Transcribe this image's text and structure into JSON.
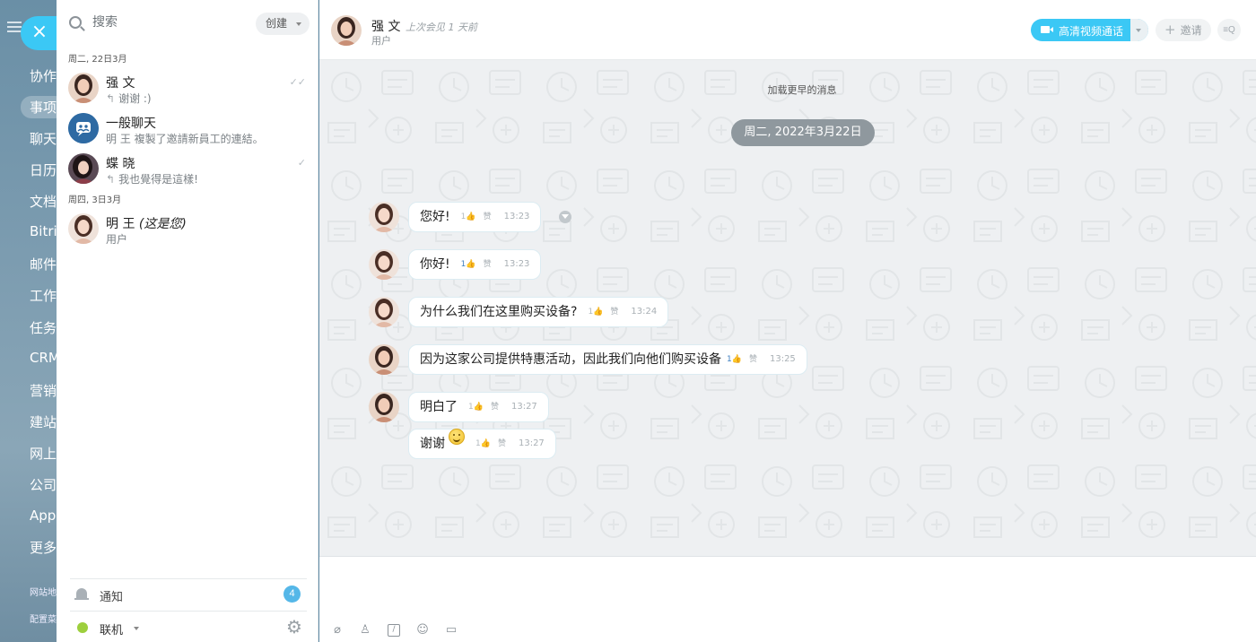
{
  "bitrix_menu": {
    "items": [
      "协作",
      "事项",
      "聊天",
      "日历",
      "文档",
      "Bitri",
      "邮件",
      "工作",
      "任务",
      "CRM",
      "营销",
      "建站",
      "网上",
      "公司",
      "Appl",
      "更多"
    ],
    "active_index": 1,
    "footer_items": [
      "网站地",
      "配置菜"
    ]
  },
  "close_icon": "×",
  "recent": {
    "search_placeholder": "搜索",
    "create_label": "创建",
    "groups": [
      {
        "date": "周二, 22日3月",
        "items": [
          {
            "name": "强 文",
            "preview": "谢谢 :)",
            "reply": true,
            "read": true,
            "avatar": "woman-1"
          },
          {
            "name": "一般聊天",
            "preview": "明 王 複製了邀請新員工的連結。",
            "reply": false,
            "read": false,
            "avatar": "group-icon"
          },
          {
            "name": "蝶 晓",
            "preview": "我也覺得是這樣!",
            "reply": true,
            "read": true,
            "avatar": "woman-2"
          }
        ]
      },
      {
        "date": "周四, 3日3月",
        "items": [
          {
            "name": "明 王",
            "name_suffix": "(这是您)",
            "preview": "用户",
            "reply": false,
            "read": false,
            "avatar": "woman-3"
          }
        ]
      }
    ],
    "notifications_label": "通知",
    "notifications_count": "4",
    "status_label": "联机",
    "status_color": "#9dcf3d"
  },
  "chat": {
    "title": "强 文",
    "last_seen": "上次会见 1 天前",
    "role": "用户",
    "video_call_label": "高清视频通话",
    "invite_label": "邀请",
    "load_earlier": "加载更早的消息",
    "date_divider": "周二, 2022年3月22日",
    "messages": [
      {
        "text": "您好!",
        "likes": "1",
        "liked": false,
        "like_label": "赞",
        "time": "13:23"
      },
      {
        "text": "你好!",
        "likes": "1",
        "liked": true,
        "like_label": "赞",
        "time": "13:23"
      },
      {
        "text": "为什么我们在这里购买设备?",
        "likes": "1",
        "liked": false,
        "like_label": "赞",
        "time": "13:24"
      },
      {
        "text": "因为这家公司提供特惠活动，因此我们向他们购买设备",
        "likes": "1",
        "liked": true,
        "like_label": "赞",
        "time": "13:25"
      },
      {
        "text": "明白了",
        "likes": "1",
        "liked": false,
        "like_label": "赞",
        "time": "13:27"
      },
      {
        "text": "谢谢",
        "emoji": "smile-emoji",
        "likes": "1",
        "liked": false,
        "like_label": "赞",
        "time": "13:27"
      }
    ],
    "toolbar_icons": [
      "attach-icon",
      "user-icon",
      "command-icon",
      "smile-icon",
      "quote-icon"
    ]
  },
  "colors": {
    "accent": "#3bc8f5",
    "date_pill": "#8f989e",
    "badge": "#55b7e8"
  }
}
